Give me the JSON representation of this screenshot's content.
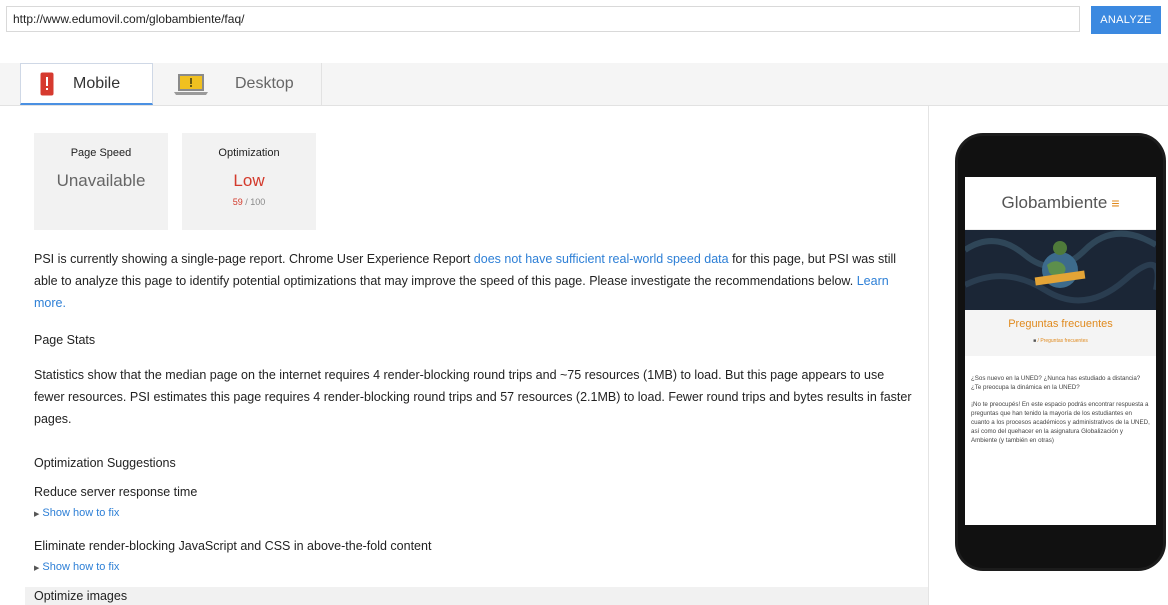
{
  "url_bar": {
    "value": "http://www.edumovil.com/globambiente/faq/"
  },
  "analyze_button": "ANALYZE",
  "tabs": [
    {
      "label": "Mobile",
      "active": true
    },
    {
      "label": "Desktop",
      "active": false
    }
  ],
  "scores": {
    "page_speed": {
      "title": "Page Speed",
      "value": "Unavailable"
    },
    "optimization": {
      "title": "Optimization",
      "value": "Low",
      "score": "59",
      "max": "/ 100",
      "color": "#d33a2c"
    }
  },
  "intro": {
    "text1": "PSI is currently showing a single-page report. Chrome User Experience Report ",
    "link1": "does not have sufficient real-world speed data",
    "text2": " for this page, but PSI was still able to analyze this page to identify potential optimizations that may improve the speed of this page. Please investigate the recommendations below. ",
    "link2": "Learn more."
  },
  "page_stats": {
    "heading": "Page Stats",
    "text": "Statistics show that the median page on the internet requires 4 render-blocking round trips and ~75 resources (1MB) to load. But this page appears to use fewer resources. PSI estimates this page requires 4 render-blocking round trips and 57 resources (2.1MB) to load. Fewer round trips and bytes results in faster pages."
  },
  "optimization_suggestions": {
    "heading": "Optimization Suggestions",
    "items": [
      {
        "title": "Reduce server response time",
        "fix": "Show how to fix"
      },
      {
        "title": "Eliminate render-blocking JavaScript and CSS in above-the-fold content",
        "fix": "Show how to fix"
      },
      {
        "title": "Optimize images"
      }
    ]
  },
  "preview": {
    "logo": "Globambiente",
    "faq_title": "Preguntas frecuentes",
    "breadcrumb": "Preguntas frecuentes",
    "p1": "¿Sos nuevo en la UNED? ¿Nunca has estudiado a distancia? ¿Te preocupa la dinámica en la UNED?",
    "p2": "¡No te preocupés! En este espacio podrás encontrar respuesta a preguntas que han tenido la mayoría de los estudiantes en cuanto a los procesos académicos y administrativos de la UNED, así como del quehacer en la asignatura Globalización y Ambiente (y también en otras)"
  },
  "colors": {
    "accent": "#3b89e0",
    "link": "#2d7fd6",
    "low": "#d33a2c",
    "orange": "#e08a1e"
  },
  "icons": {
    "mobile_tab": "mobile-phone-icon",
    "desktop_tab": "laptop-icon",
    "fix_toggle": "triangle-right-icon",
    "home": "home-icon"
  }
}
